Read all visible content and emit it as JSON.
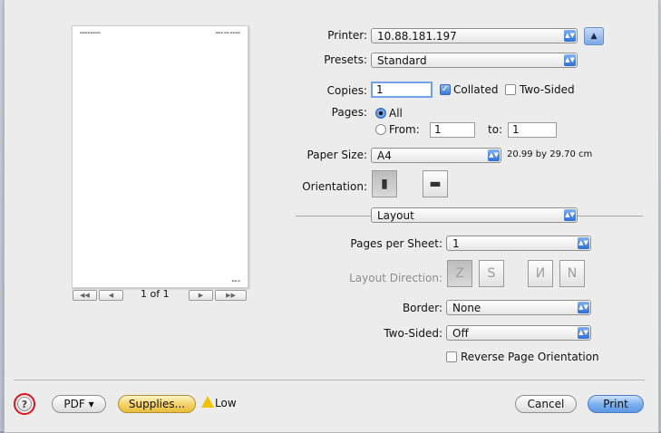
{
  "printer": {
    "label": "Printer:",
    "value": "10.88.181.197"
  },
  "presets": {
    "label": "Presets:",
    "value": "Standard"
  },
  "copies": {
    "label": "Copies:",
    "value": "1",
    "collated_label": "Collated",
    "collated_checked": true,
    "two_sided_label": "Two-Sided",
    "two_sided_checked": false
  },
  "pages": {
    "label": "Pages:",
    "all_label": "All",
    "from_label": "From:",
    "from_value": "1",
    "to_label": "to:",
    "to_value": "1"
  },
  "paper_size": {
    "label": "Paper Size:",
    "value": "A4",
    "dimensions": "20.99 by 29.70 cm"
  },
  "orientation": {
    "label": "Orientation:"
  },
  "section": {
    "value": "Layout"
  },
  "pages_per_sheet": {
    "label": "Pages per Sheet:",
    "value": "1"
  },
  "layout_direction": {
    "label": "Layout Direction:"
  },
  "border": {
    "label": "Border:",
    "value": "None"
  },
  "two_sided": {
    "label": "Two-Sided:",
    "value": "Off"
  },
  "reverse": {
    "label": "Reverse Page Orientation",
    "checked": false
  },
  "preview": {
    "page_indicator": "1 of 1"
  },
  "footer": {
    "help": "?",
    "pdf": "PDF ▾",
    "supplies": "Supplies...",
    "supply_status": "Low",
    "cancel": "Cancel",
    "print": "Print"
  },
  "colors": {
    "accent": "#3b78d8",
    "help_highlight": "#d8141c",
    "warning": "#f2c200"
  },
  "icons": {
    "printer_expand": "triangle-up-icon",
    "warning": "warning-triangle-icon",
    "portrait": "portrait-icon",
    "landscape": "landscape-icon"
  }
}
